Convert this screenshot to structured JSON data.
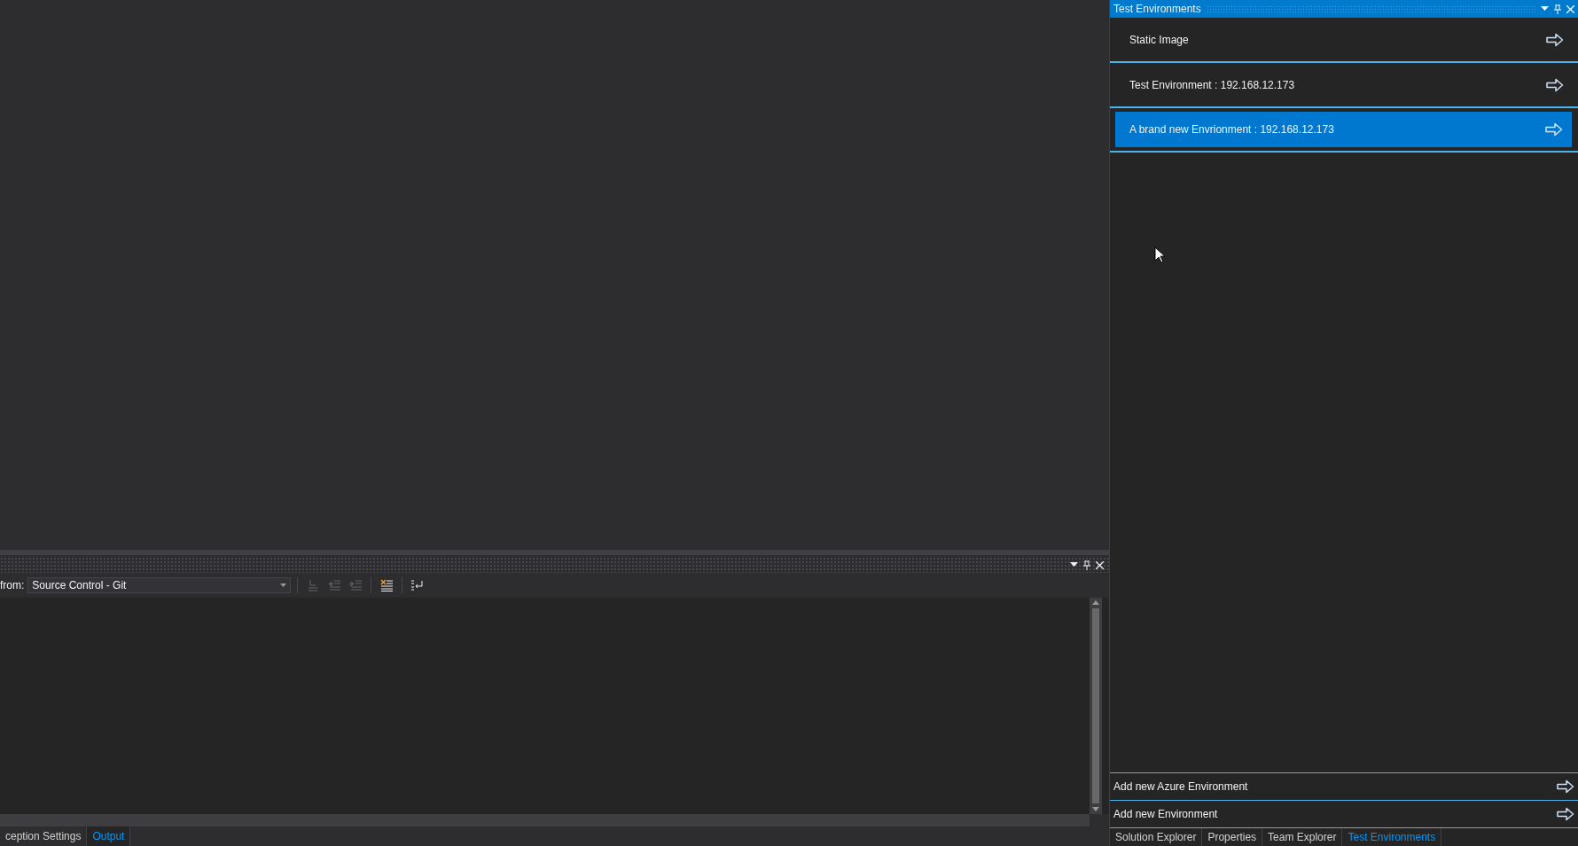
{
  "output_pane": {
    "source_label": "from:",
    "source_value": "Source Control - Git",
    "toolbar_buttons": [
      {
        "kind": "goto",
        "disabled": true
      },
      {
        "kind": "outdent",
        "disabled": true
      },
      {
        "kind": "indent",
        "disabled": true
      },
      {
        "kind": "clear",
        "disabled": false
      },
      {
        "kind": "wrap",
        "disabled": false
      }
    ],
    "tabs": [
      {
        "label": "ception Settings",
        "selected": false
      },
      {
        "label": "Output",
        "selected": true
      }
    ]
  },
  "test_environments": {
    "title": "Test Environments",
    "environments": [
      {
        "label": "Static Image",
        "selected": false
      },
      {
        "label": "Test Environment : 192.168.12.173",
        "selected": false
      },
      {
        "label": "A brand new Envrionment : 192.168.12.173",
        "selected": true
      }
    ],
    "actions": [
      "Add new Azure Environment",
      "Add new Environment"
    ],
    "tabs": [
      {
        "label": "Solution Explorer",
        "selected": false
      },
      {
        "label": "Properties",
        "selected": false
      },
      {
        "label": "Team Explorer",
        "selected": false
      },
      {
        "label": "Test Environments",
        "selected": true
      }
    ]
  }
}
